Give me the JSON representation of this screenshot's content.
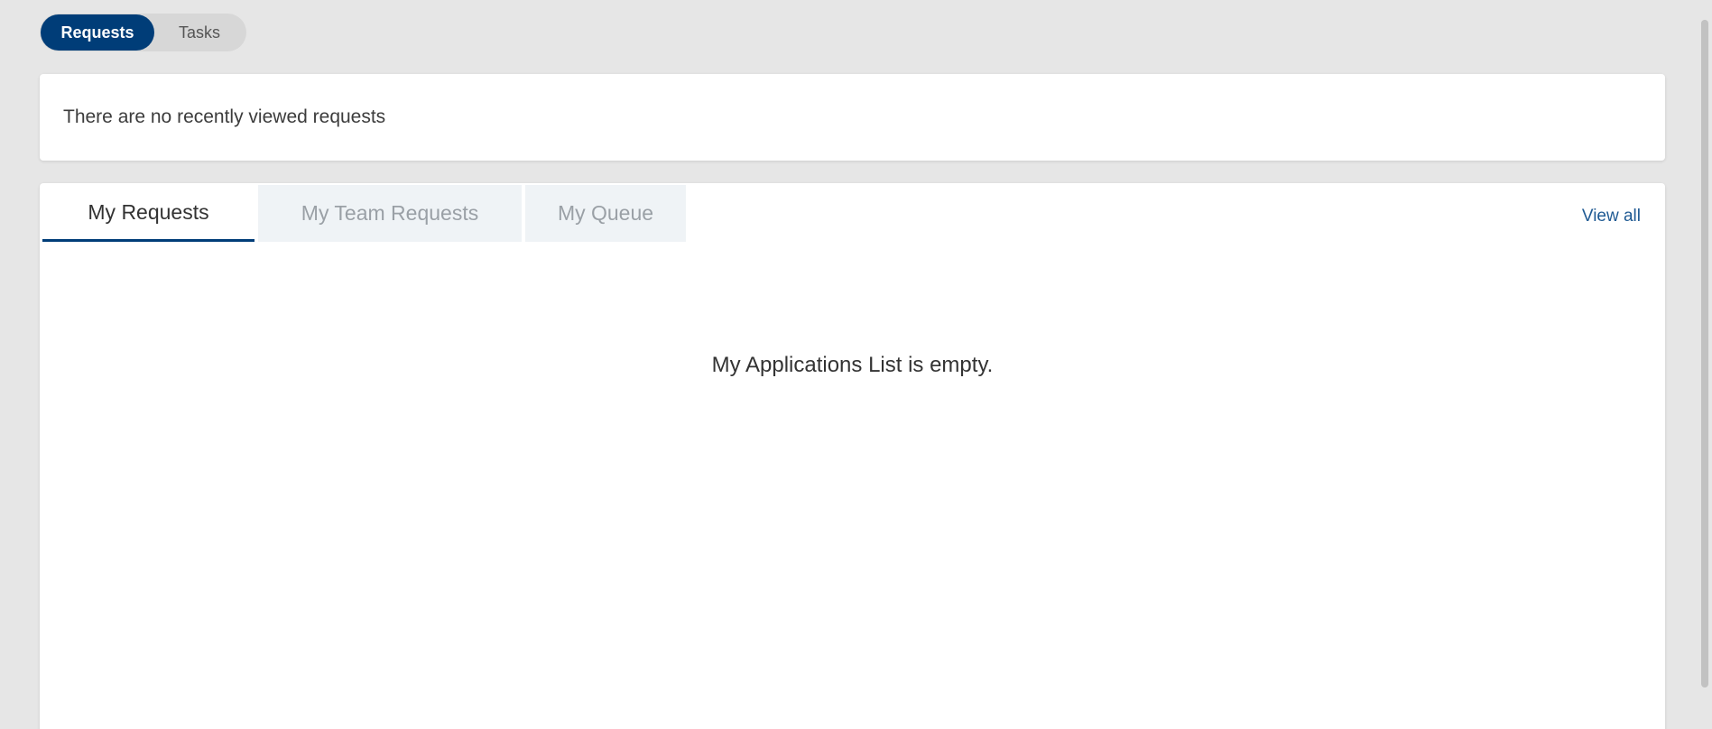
{
  "toggle": {
    "requests_label": "Requests",
    "tasks_label": "Tasks"
  },
  "recent": {
    "message": "There are no recently viewed requests"
  },
  "main": {
    "tabs": [
      {
        "label": "My Requests",
        "active": true
      },
      {
        "label": "My Team Requests",
        "active": false
      },
      {
        "label": "My Queue",
        "active": false
      }
    ],
    "view_all_label": "View all",
    "empty_message": "My Applications List is empty."
  },
  "colors": {
    "accent": "#003d78",
    "link": "#1f5a93",
    "background": "#e6e6e6",
    "inactive_tab_bg": "#eff3f6"
  }
}
